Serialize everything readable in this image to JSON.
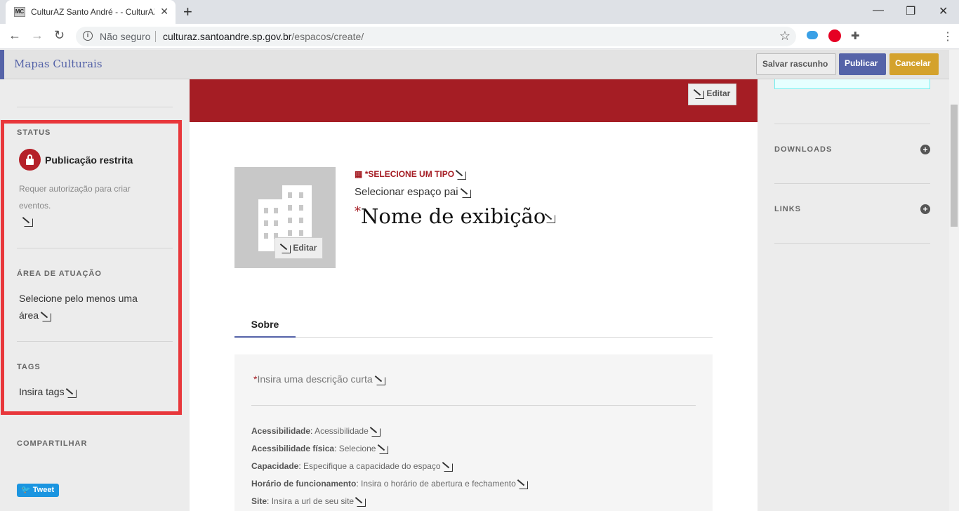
{
  "browser": {
    "tab_title": "CulturAZ Santo André - - CulturAZ Santo André",
    "tab_favicon": "MC",
    "security_label": "Não seguro",
    "url_host": "culturaz.santoandre.sp.gov.br",
    "url_path": "/espacos/create/"
  },
  "appbar": {
    "brand": "Mapas Culturais",
    "draft_label": "Salvar rascunho",
    "publish_label": "Publicar",
    "cancel_label": "Cancelar"
  },
  "left": {
    "status_title": "STATUS",
    "status_value": "Publicação restrita",
    "status_desc_1": "Requer autorização para criar",
    "status_desc_2": "eventos.",
    "area_title": "ÁREA DE ATUAÇÃO",
    "area_value_1": "Selecione pelo menos uma",
    "area_value_2": "área",
    "tags_title": "TAGS",
    "tags_value": "Insira tags",
    "share_title": "COMPARTILHAR",
    "tweet_label": "Tweet"
  },
  "center": {
    "cover_edit": "Editar",
    "avatar_edit": "Editar",
    "type_label": "*SELECIONE UM TIPO",
    "parent_label": "Selecionar espaço pai",
    "name_required": "*",
    "name_label": "Nome de exibição",
    "tab_about": "Sobre",
    "short_desc_required": "*",
    "short_desc": "Insira uma descrição curta",
    "meta": [
      {
        "label": "Acessibilidade",
        "value": "Acessibilidade"
      },
      {
        "label": "Acessibilidade física",
        "value": "Selecione"
      },
      {
        "label": "Capacidade",
        "value": "Especifique a capacidade do espaço"
      },
      {
        "label": "Horário de funcionamento",
        "value": "Insira o horário de abertura e fechamento"
      },
      {
        "label": "Site",
        "value": "Insira a url de seu site"
      }
    ]
  },
  "right": {
    "downloads_title": "DOWNLOADS",
    "links_title": "LINKS"
  },
  "colors": {
    "accent": "#5563a8",
    "cover": "#a51d24",
    "cancel": "#d4a22c",
    "highlight": "#e8373b"
  }
}
